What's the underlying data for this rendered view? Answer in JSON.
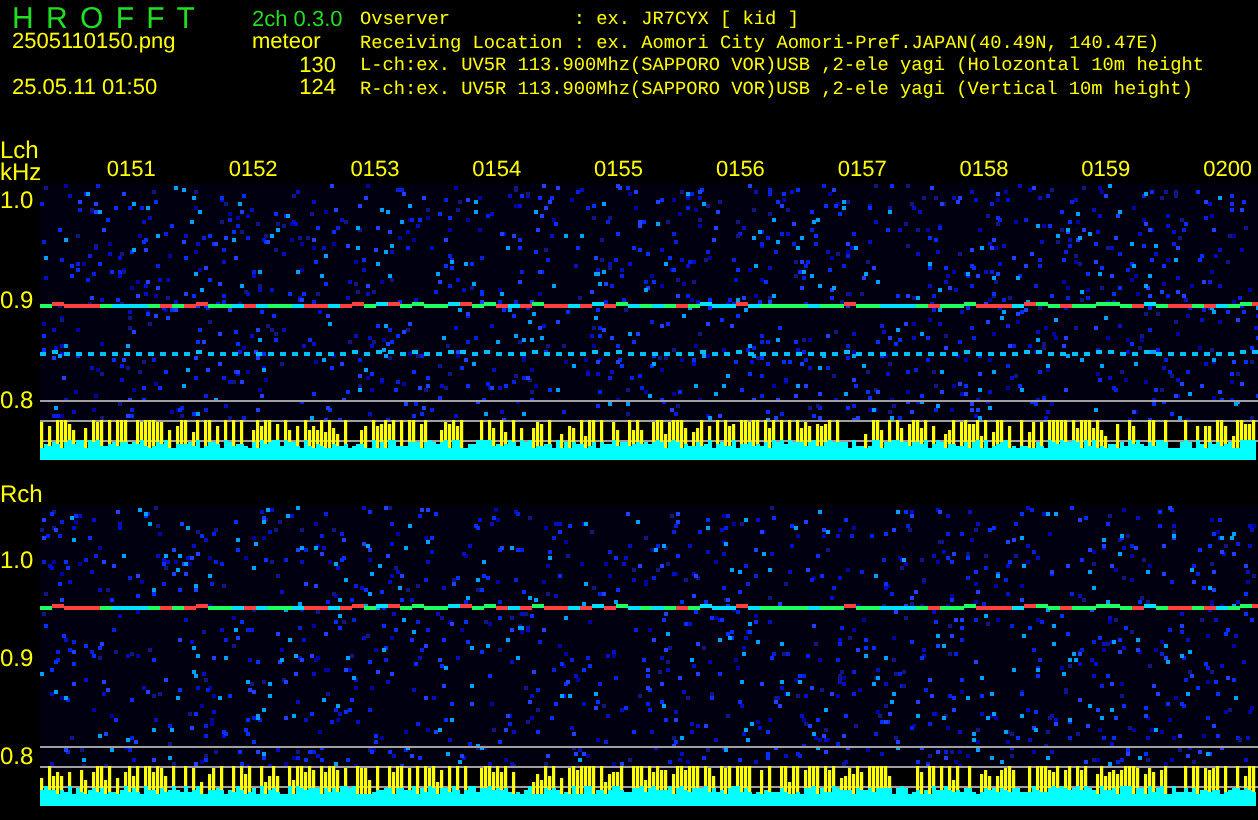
{
  "header": {
    "app_title": "H R O F F T",
    "version": "2ch 0.3.0",
    "filename": "2505110150.png",
    "datetime": "25.05.11 01:50",
    "meteor_label": "meteor",
    "meteor_counts": [
      "130",
      "124"
    ],
    "info_lines": [
      {
        "label": "Ovserver",
        "value": ": ex. JR7CYX [ kid ]"
      },
      {
        "label": "Receiving Location",
        "value": ": ex. Aomori City Aomori-Pref.JAPAN(40.49N, 140.47E)"
      },
      {
        "text": "L-ch:ex. UV5R 113.900Mhz(SAPPORO VOR)USB ,2-ele yagi (Holozontal 10m height"
      },
      {
        "text": "R-ch:ex. UV5R 113.900Mhz(SAPPORO VOR)USB ,2-ele yagi (Vertical 10m height)"
      }
    ]
  },
  "channels": [
    {
      "label": "Lch",
      "unit": "kHz",
      "time_labels": [
        "0151",
        "0152",
        "0153",
        "0154",
        "0155",
        "0156",
        "0157",
        "0158",
        "0159",
        "0200"
      ],
      "y_ticks": [
        "1.0",
        "0.9",
        "0.8"
      ]
    },
    {
      "label": "Rch",
      "y_ticks": [
        "1.0",
        "0.9",
        "0.8"
      ]
    }
  ]
}
